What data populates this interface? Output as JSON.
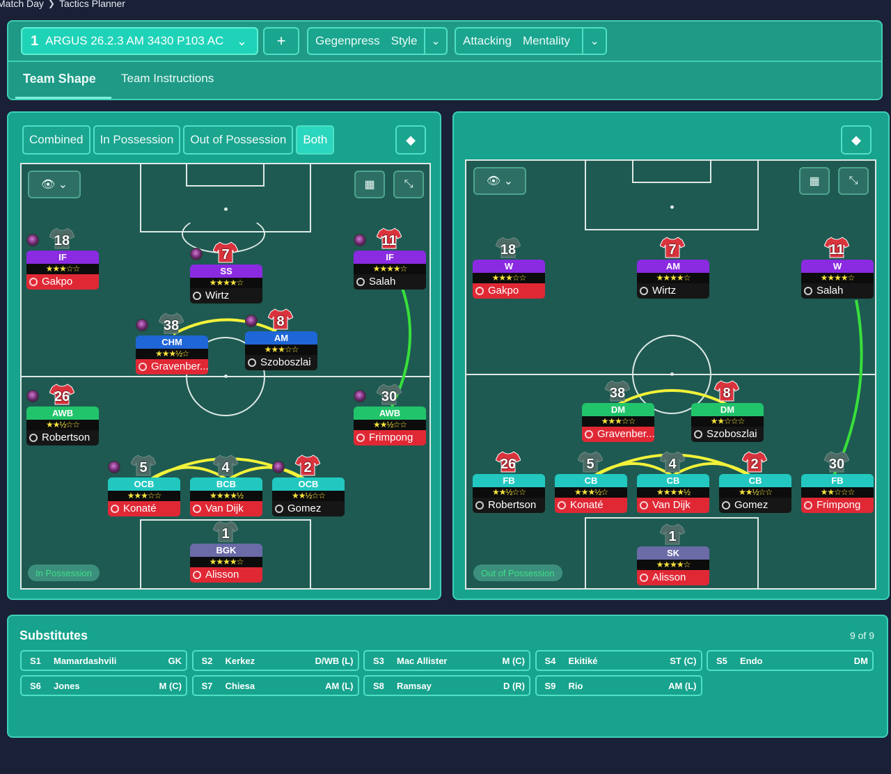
{
  "breadcrumb": {
    "parent": "Match Day",
    "current": "Tactics Planner"
  },
  "tactic": {
    "number": "1",
    "name": "ARGUS 26.2.3 AM 3430 P103 AC"
  },
  "style": {
    "a": "Gegenpress",
    "b": "Style"
  },
  "mentality": {
    "a": "Attacking",
    "b": "Mentality"
  },
  "tabs": {
    "shape": "Team Shape",
    "instructions": "Team Instructions"
  },
  "view_tabs": [
    "Combined",
    "In Possession",
    "Out of Possession",
    "Both"
  ],
  "phase": {
    "left": "In Possession",
    "right": "Out of Possession"
  },
  "colors": {
    "panel": "#17a38d",
    "pitch": "#1e5a52",
    "link_yellow": "#f2f23a",
    "link_green": "#38e03a"
  },
  "left_players": [
    {
      "num": "18",
      "role": "IF",
      "stars": "★★★☆☆",
      "name": "Gakpo",
      "name_style": "red",
      "role_color": "#8a2be2",
      "orb": true,
      "shirt": "grey"
    },
    {
      "num": "7",
      "role": "SS",
      "stars": "★★★★☆",
      "name": "Wirtz",
      "name_style": "dark",
      "role_color": "#8a2be2",
      "orb": true,
      "shirt": "red"
    },
    {
      "num": "11",
      "role": "IF",
      "stars": "★★★★☆",
      "name": "Salah",
      "name_style": "dark",
      "role_color": "#8a2be2",
      "orb": true,
      "shirt": "red"
    },
    {
      "num": "38",
      "role": "CHM",
      "stars": "★★★½☆",
      "name": "Gravenber...",
      "name_style": "red",
      "role_color": "#1f66d6",
      "orb": true,
      "shirt": "grey"
    },
    {
      "num": "8",
      "role": "AM",
      "stars": "★★★☆☆",
      "name": "Szoboszlai",
      "name_style": "dark",
      "role_color": "#1f66d6",
      "orb": true,
      "shirt": "red"
    },
    {
      "num": "26",
      "role": "AWB",
      "stars": "★★½☆☆",
      "name": "Robertson",
      "name_style": "dark",
      "role_color": "#22c46b",
      "orb": true,
      "shirt": "red"
    },
    {
      "num": "30",
      "role": "AWB",
      "stars": "★★½☆☆",
      "name": "Frimpong",
      "name_style": "red",
      "role_color": "#22c46b",
      "orb": true,
      "shirt": "grey"
    },
    {
      "num": "5",
      "role": "OCB",
      "stars": "★★★☆☆",
      "name": "Konaté",
      "name_style": "red",
      "role_color": "#22c8c0",
      "orb": true,
      "shirt": "grey"
    },
    {
      "num": "4",
      "role": "BCB",
      "stars": "★★★★½",
      "name": "Van Dijk",
      "name_style": "red",
      "role_color": "#22c8c0",
      "orb": false,
      "shirt": "grey"
    },
    {
      "num": "2",
      "role": "OCB",
      "stars": "★★½☆☆",
      "name": "Gomez",
      "name_style": "dark",
      "role_color": "#22c8c0",
      "orb": true,
      "shirt": "red"
    },
    {
      "num": "1",
      "role": "BGK",
      "stars": "★★★★☆",
      "name": "Alisson",
      "name_style": "red",
      "role_color": "#6b6ba8",
      "orb": false,
      "shirt": "grey"
    }
  ],
  "right_players": [
    {
      "num": "18",
      "role": "W",
      "stars": "★★★☆☆",
      "name": "Gakpo",
      "name_style": "red",
      "role_color": "#8a2be2",
      "orb": false,
      "shirt": "grey"
    },
    {
      "num": "7",
      "role": "AM",
      "stars": "★★★★☆",
      "name": "Wirtz",
      "name_style": "dark",
      "role_color": "#8a2be2",
      "orb": false,
      "shirt": "red"
    },
    {
      "num": "11",
      "role": "W",
      "stars": "★★★★☆",
      "name": "Salah",
      "name_style": "dark",
      "role_color": "#8a2be2",
      "orb": false,
      "shirt": "red"
    },
    {
      "num": "38",
      "role": "DM",
      "stars": "★★★☆☆",
      "name": "Gravenber...",
      "name_style": "red",
      "role_color": "#22c46b",
      "orb": false,
      "shirt": "grey"
    },
    {
      "num": "8",
      "role": "DM",
      "stars": "★★☆☆☆",
      "name": "Szoboszlai",
      "name_style": "dark",
      "role_color": "#22c46b",
      "orb": false,
      "shirt": "red"
    },
    {
      "num": "26",
      "role": "FB",
      "stars": "★★½☆☆",
      "name": "Robertson",
      "name_style": "dark",
      "role_color": "#22c8c0",
      "orb": false,
      "shirt": "red"
    },
    {
      "num": "5",
      "role": "CB",
      "stars": "★★★½☆",
      "name": "Konaté",
      "name_style": "red",
      "role_color": "#22c8c0",
      "orb": false,
      "shirt": "grey"
    },
    {
      "num": "4",
      "role": "CB",
      "stars": "★★★★½",
      "name": "Van Dijk",
      "name_style": "red",
      "role_color": "#22c8c0",
      "orb": false,
      "shirt": "grey"
    },
    {
      "num": "2",
      "role": "CB",
      "stars": "★★½☆☆",
      "name": "Gomez",
      "name_style": "dark",
      "role_color": "#22c8c0",
      "orb": false,
      "shirt": "red"
    },
    {
      "num": "30",
      "role": "FB",
      "stars": "★★☆☆☆",
      "name": "Frimpong",
      "name_style": "red",
      "role_color": "#22c8c0",
      "orb": false,
      "shirt": "grey"
    },
    {
      "num": "1",
      "role": "SK",
      "stars": "★★★★☆",
      "name": "Alisson",
      "name_style": "red",
      "role_color": "#6b6ba8",
      "orb": false,
      "shirt": "grey"
    }
  ],
  "substitutes": {
    "title": "Substitutes",
    "count": "9 of 9",
    "items": [
      {
        "id": "S1",
        "name": "Mamardashvili",
        "pos": "GK"
      },
      {
        "id": "S2",
        "name": "Kerkez",
        "pos": "D/WB (L)"
      },
      {
        "id": "S3",
        "name": "Mac Allister",
        "pos": "M (C)"
      },
      {
        "id": "S4",
        "name": "Ekitiké",
        "pos": "ST (C)"
      },
      {
        "id": "S5",
        "name": "Endo",
        "pos": "DM"
      },
      {
        "id": "S6",
        "name": "Jones",
        "pos": "M (C)"
      },
      {
        "id": "S7",
        "name": "Chiesa",
        "pos": "AM (L)"
      },
      {
        "id": "S8",
        "name": "Ramsay",
        "pos": "D (R)"
      },
      {
        "id": "S9",
        "name": "Rio",
        "pos": "AM (L)"
      }
    ]
  }
}
